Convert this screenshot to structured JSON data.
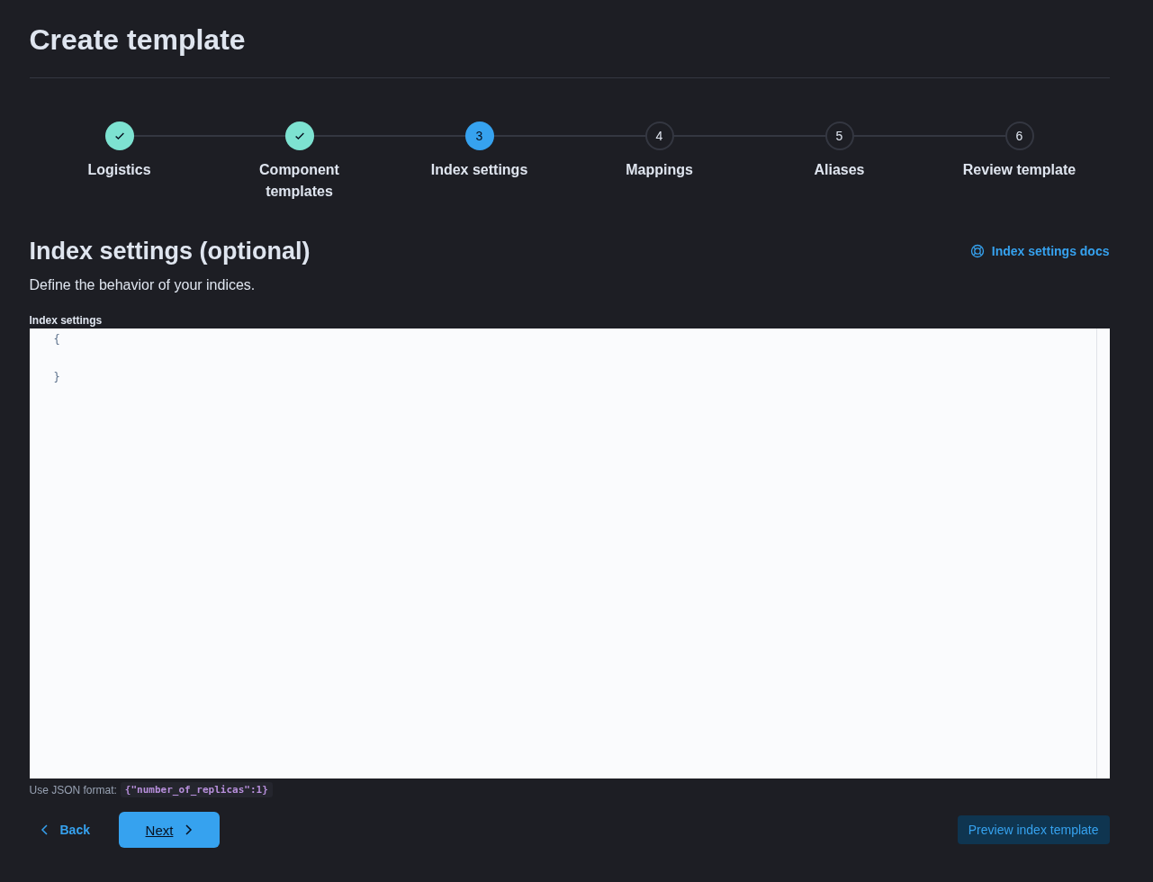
{
  "page": {
    "title": "Create template"
  },
  "steps": [
    {
      "label": "Logistics",
      "complete": true,
      "selected": false
    },
    {
      "label": "Component templates",
      "complete": true,
      "selected": false
    },
    {
      "label": "Index settings",
      "complete": false,
      "selected": true,
      "number": "3"
    },
    {
      "label": "Mappings",
      "complete": false,
      "selected": false,
      "number": "4"
    },
    {
      "label": "Aliases",
      "complete": false,
      "selected": false,
      "number": "5"
    },
    {
      "label": "Review template",
      "complete": false,
      "selected": false,
      "number": "6"
    }
  ],
  "section": {
    "title": "Index settings (optional)",
    "description": "Define the behavior of your indices.",
    "docs_link": "Index settings docs"
  },
  "editor": {
    "label": "Index settings",
    "code": "{\n\n}",
    "help": "Use JSON format:",
    "help_example": "{\"number_of_replicas\":1}"
  },
  "footer": {
    "back": "Back",
    "next": "Next",
    "preview": "Preview index template"
  }
}
